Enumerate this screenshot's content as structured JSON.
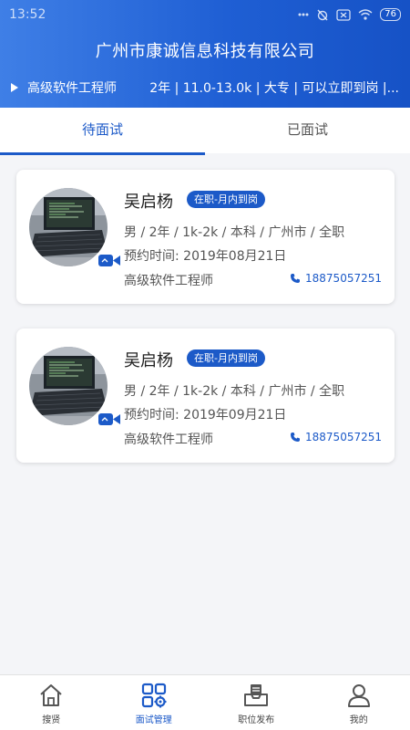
{
  "status_bar": {
    "time": "13:52",
    "battery": "76"
  },
  "header": {
    "company": "广州市康诚信息科技有限公司",
    "job_title": "高级软件工程师",
    "job_meta": "2年 | 11.0-13.0k | 大专 | 可以立即到岗 |..."
  },
  "tabs": [
    {
      "label": "待面试",
      "active": true
    },
    {
      "label": "已面试",
      "active": false
    }
  ],
  "cards": [
    {
      "name": "吴启杨",
      "badge": "在职-月内到岗",
      "details": "男 / 2年 / 1k-2k / 本科 / 广州市 / 全职",
      "appointment": "预约时间: 2019年08月21日",
      "position": "高级软件工程师",
      "phone": "18875057251"
    },
    {
      "name": "吴启杨",
      "badge": "在职-月内到岗",
      "details": "男 / 2年 / 1k-2k / 本科 / 广州市 / 全职",
      "appointment": "预约时间: 2019年09月21日",
      "position": "高级软件工程师",
      "phone": "18875057251"
    }
  ],
  "bottom_nav": [
    {
      "label": "搜贤",
      "icon": "home-icon",
      "active": false
    },
    {
      "label": "面试管理",
      "icon": "grid-settings-icon",
      "active": true
    },
    {
      "label": "职位发布",
      "icon": "post-tray-icon",
      "active": false
    },
    {
      "label": "我的",
      "icon": "person-icon",
      "active": false
    }
  ],
  "colors": {
    "primary": "#1c5ac8",
    "header_start": "#3f7fe6",
    "header_end": "#1652c6"
  }
}
